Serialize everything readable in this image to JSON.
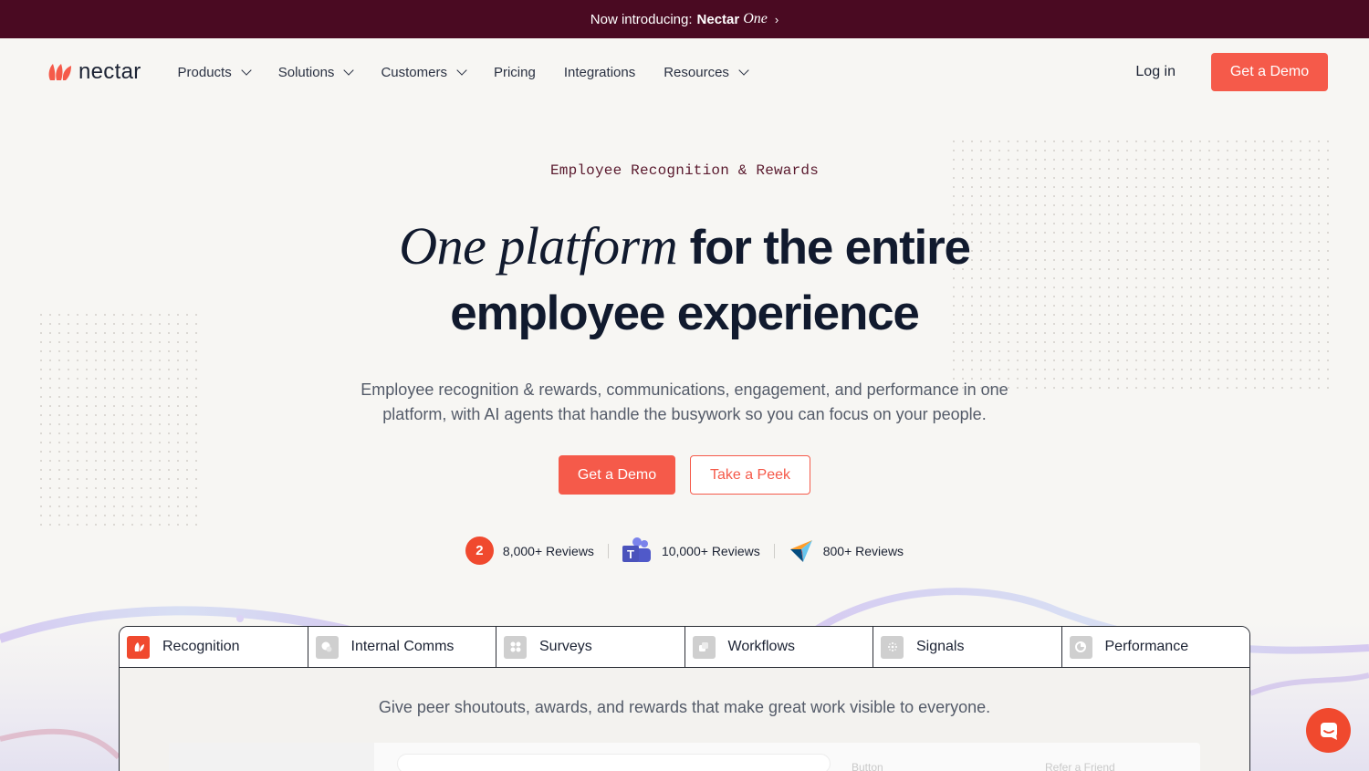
{
  "announcement": {
    "prefix": "Now introducing:",
    "brand": "Nectar",
    "product": "One",
    "chevron": "›"
  },
  "nav": {
    "logo_text": "nectar",
    "items": [
      {
        "label": "Products",
        "has_dropdown": true
      },
      {
        "label": "Solutions",
        "has_dropdown": true
      },
      {
        "label": "Customers",
        "has_dropdown": true
      },
      {
        "label": "Pricing",
        "has_dropdown": false
      },
      {
        "label": "Integrations",
        "has_dropdown": false
      },
      {
        "label": "Resources",
        "has_dropdown": true
      }
    ],
    "login": "Log in",
    "demo": "Get a Demo"
  },
  "hero": {
    "eyebrow": "Employee Recognition & Rewards",
    "headline_serif": "One platform",
    "headline_rest": "for the entire",
    "headline_line2": "employee experience",
    "subtitle": "Employee recognition & rewards, communications, engagement, and performance in one platform, with AI agents that handle the busywork so you can focus on your people.",
    "cta_primary": "Get a Demo",
    "cta_secondary": "Take a Peek"
  },
  "reviews": [
    {
      "icon": "g2-icon",
      "text": "8,000+ Reviews"
    },
    {
      "icon": "teams-icon",
      "text": "10,000+ Reviews"
    },
    {
      "icon": "capterra-icon",
      "text": "800+ Reviews"
    }
  ],
  "g2_label": "2",
  "teams_label": "T",
  "panel": {
    "tabs": [
      {
        "label": "Recognition",
        "active": true
      },
      {
        "label": "Internal Comms",
        "active": false
      },
      {
        "label": "Surveys",
        "active": false
      },
      {
        "label": "Workflows",
        "active": false
      },
      {
        "label": "Signals",
        "active": false
      },
      {
        "label": "Performance",
        "active": false
      }
    ],
    "description": "Give peer shoutouts, awards, and rewards that make great work visible to everyone.",
    "preview_button": "Button",
    "preview_refer": "Refer a Friend"
  },
  "colors": {
    "accent": "#f55a4a",
    "announcement_bg": "#4a0a22",
    "heading": "#111a2e"
  }
}
